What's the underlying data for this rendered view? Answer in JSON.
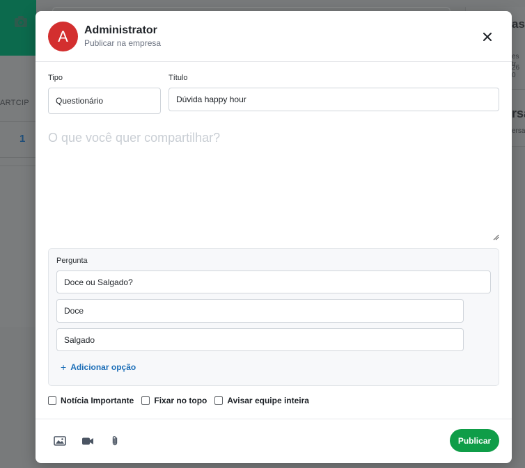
{
  "background": {
    "left_header_fragment": "ARTCIP",
    "left_count": "1",
    "right_title_fragment": "as",
    "right_line1": "es tr",
    "right_line2": "26 0",
    "right_title2_fragment": "rsa",
    "right_line3": "ersa"
  },
  "composer": {
    "avatar_letter": "A",
    "user_name": "Administrator",
    "subtitle": "Publicar na empresa",
    "type_label": "Tipo",
    "type_value": "Questionário",
    "title_label": "Título",
    "title_value": "Dúvida happy hour",
    "body_placeholder": "O que você quer compartilhar?",
    "poll": {
      "question_label": "Pergunta",
      "question_value": "Doce ou Salgado?",
      "options": [
        "Doce",
        "Salgado"
      ],
      "add_option_label": "Adicionar opção"
    },
    "checkboxes": [
      "Notícia Importante",
      "Fixar no topo",
      "Avisar equipe inteira"
    ],
    "tools": [
      "image-icon",
      "video-icon",
      "attachment-icon"
    ],
    "publish_label": "Publicar"
  },
  "colors": {
    "avatar": "#d32f2f",
    "primary_button": "#0f9d48",
    "link": "#1d6fb8",
    "sidebar_green": "#0c6a4d"
  }
}
